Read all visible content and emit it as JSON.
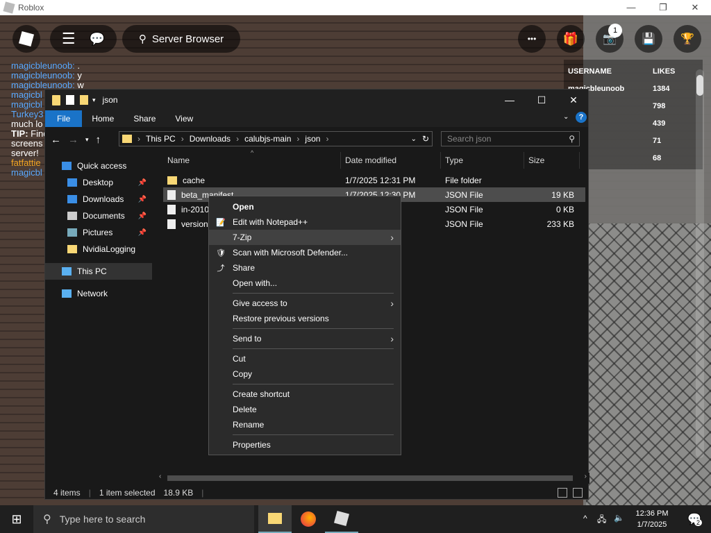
{
  "roblox": {
    "window_title": "Roblox",
    "server_browser": "Server Browser",
    "notification_count": "1",
    "chat": [
      {
        "user": "magicbleunoob:",
        "msg": " ."
      },
      {
        "user": "magicbleunoob:",
        "msg": " y"
      },
      {
        "user": "magicbleunoob:",
        "msg": " w"
      },
      {
        "user": "magicbl",
        "msg": ""
      },
      {
        "user": "magicbl",
        "msg": ""
      },
      {
        "user": "Turkey3",
        "msg": ""
      },
      {
        "user": "",
        "msg": "much lo"
      },
      {
        "user": "TIP:",
        "msg": " Find"
      },
      {
        "user": "",
        "msg": "screens"
      },
      {
        "user": "",
        "msg": "server!"
      },
      {
        "user": "fatfattie",
        "msg": ""
      },
      {
        "user": "magicbl",
        "msg": ""
      }
    ],
    "leaderboard": {
      "headers": [
        "USERNAME",
        "LIKES"
      ],
      "rows": [
        [
          "magicbleunoob",
          "1384"
        ],
        [
          "eman",
          "798"
        ],
        [
          "ic",
          "439"
        ],
        [
          "e",
          "71"
        ],
        [
          "n",
          "68"
        ]
      ]
    }
  },
  "explorer": {
    "title": "json",
    "ribbon": [
      "File",
      "Home",
      "Share",
      "View"
    ],
    "breadcrumb": [
      "This PC",
      "Downloads",
      "calubjs-main",
      "json"
    ],
    "search_placeholder": "Search json",
    "nav": [
      {
        "label": "Quick access",
        "icon": "star-icon",
        "pinned": false
      },
      {
        "label": "Desktop",
        "icon": "desktop-icon",
        "pinned": true
      },
      {
        "label": "Downloads",
        "icon": "download-icon",
        "pinned": true
      },
      {
        "label": "Documents",
        "icon": "document-icon",
        "pinned": true
      },
      {
        "label": "Pictures",
        "icon": "picture-icon",
        "pinned": true
      },
      {
        "label": "NvidiaLogging",
        "icon": "folder-icon",
        "pinned": false
      },
      {
        "label": "This PC",
        "icon": "computer-icon",
        "pinned": false
      },
      {
        "label": "Network",
        "icon": "network-icon",
        "pinned": false
      }
    ],
    "columns": [
      "Name",
      "Date modified",
      "Type",
      "Size"
    ],
    "files": [
      {
        "name": "cache",
        "date": "1/7/2025 12:31 PM",
        "type": "File folder",
        "size": ""
      },
      {
        "name": "beta_manifest",
        "date": "1/7/2025 12:30 PM",
        "type": "JSON File",
        "size": "19 KB"
      },
      {
        "name": "in-2010",
        "date": "PM",
        "type": "JSON File",
        "size": "0 KB"
      },
      {
        "name": "version",
        "date": "PM",
        "type": "JSON File",
        "size": "233 KB"
      }
    ],
    "status": {
      "items": "4 items",
      "selected": "1 item selected",
      "size": "18.9 KB"
    }
  },
  "context_menu": {
    "groups": [
      [
        {
          "label": "Open",
          "icon": "",
          "bold": true
        },
        {
          "label": "Edit with Notepad++",
          "icon": "notepad-icon"
        },
        {
          "label": "7-Zip",
          "icon": "",
          "submenu": true
        },
        {
          "label": "Scan with Microsoft Defender...",
          "icon": "defender-icon"
        },
        {
          "label": "Share",
          "icon": "share-icon"
        },
        {
          "label": "Open with...",
          "icon": ""
        }
      ],
      [
        {
          "label": "Give access to",
          "icon": "",
          "submenu": true
        },
        {
          "label": "Restore previous versions",
          "icon": ""
        }
      ],
      [
        {
          "label": "Send to",
          "icon": "",
          "submenu": true
        }
      ],
      [
        {
          "label": "Cut",
          "icon": ""
        },
        {
          "label": "Copy",
          "icon": ""
        }
      ],
      [
        {
          "label": "Create shortcut",
          "icon": ""
        },
        {
          "label": "Delete",
          "icon": ""
        },
        {
          "label": "Rename",
          "icon": ""
        }
      ],
      [
        {
          "label": "Properties",
          "icon": ""
        }
      ]
    ]
  },
  "taskbar": {
    "search_placeholder": "Type here to search",
    "time": "12:36 PM",
    "date": "1/7/2025",
    "notifications": "2"
  }
}
